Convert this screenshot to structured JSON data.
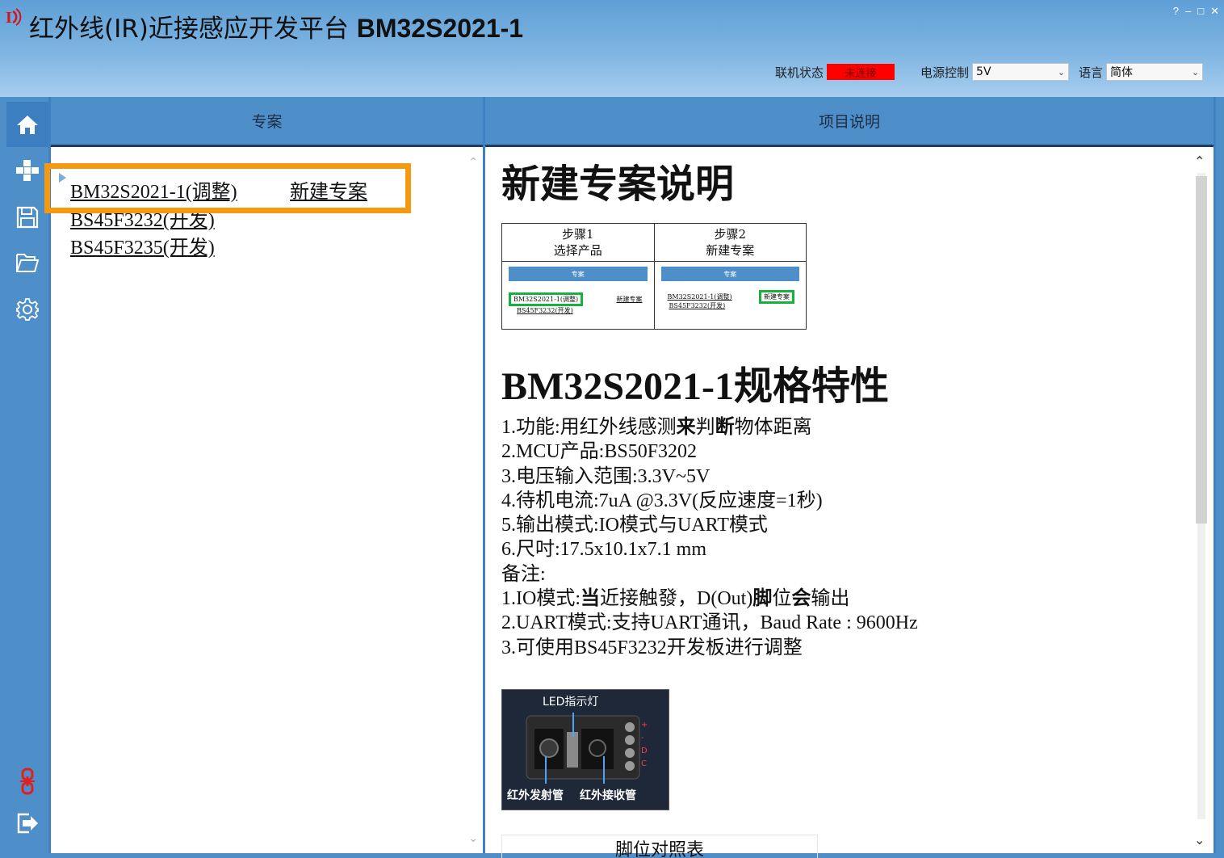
{
  "app": {
    "title_cn": "红外线(IR)近接感应开发平台 ",
    "title_model": "BM32S2021-1"
  },
  "window": {
    "help": "?",
    "minimize": "–",
    "maximize": "□",
    "close": "✕"
  },
  "status": {
    "conn_label": "联机状态",
    "conn_value": "未连接",
    "power_label": "电源控制",
    "power_value": "5V",
    "lang_label": "语言",
    "lang_value": "简体"
  },
  "nav": {
    "items": [
      "home-icon",
      "modules-icon",
      "save-icon",
      "open-folder-icon",
      "settings-icon"
    ],
    "bottom": [
      "link-icon",
      "exit-icon"
    ]
  },
  "left_panel": {
    "header": "专案",
    "projects": [
      "BM32S2021-1(调整)",
      "BS45F3232(开发)",
      "BS45F3235(开发)"
    ],
    "new_project": "新建专案"
  },
  "right_panel": {
    "header": "项目说明",
    "doc_title": "新建专案说明",
    "steps": [
      {
        "step": "步骤1",
        "desc": "选择产品"
      },
      {
        "step": "步骤2",
        "desc": "新建专案"
      }
    ],
    "mini": {
      "bar": "专案",
      "item1": "BM32S2021-1(调整)",
      "item2": "BS45F3232(开发)",
      "new": "新建专案"
    },
    "spec_title": "BM32S2021-1规格特性",
    "spec_lines": [
      "1.功能:用红外线感测",
      "来",
      "判",
      "断",
      "物体距离"
    ],
    "specs": {
      "l1a": "1.功能:用红外线感测",
      "l1b": "来",
      "l1c": "判",
      "l1d": "断",
      "l1e": "物体距离",
      "l2": "2.MCU产品:BS50F3202",
      "l3": "3.电压输入范围:3.3V~5V",
      "l4": "4.待机电流:7uA @3.3V(反应速度=1秒)",
      "l5": "5.输出模式:IO模式与UART模式",
      "l6": "6.尺吋:17.5x10.1x7.1 mm",
      "note": "备注:",
      "n1a": "1.IO模式:",
      "n1b": "当",
      "n1c": "近接触發，D(Out)",
      "n1d": "脚",
      "n1e": "位",
      "n1f": "会",
      "n1g": "输出",
      "n2": "2.UART模式:支持UART通讯，Baud Rate : 9600Hz",
      "n3": "3.可使用BS45F3232开发板进行调整"
    },
    "photo": {
      "led": "LED指示灯",
      "emitter": "红外发射管",
      "receiver": "红外接收管",
      "pins": [
        "+",
        "-",
        "D",
        "C"
      ]
    },
    "pin_table": "脚位对照表"
  },
  "colors": {
    "accent": "#4f8fc9",
    "highlight": "#f59a10",
    "status_red": "#ff0000",
    "mini_green": "#15b33d"
  }
}
